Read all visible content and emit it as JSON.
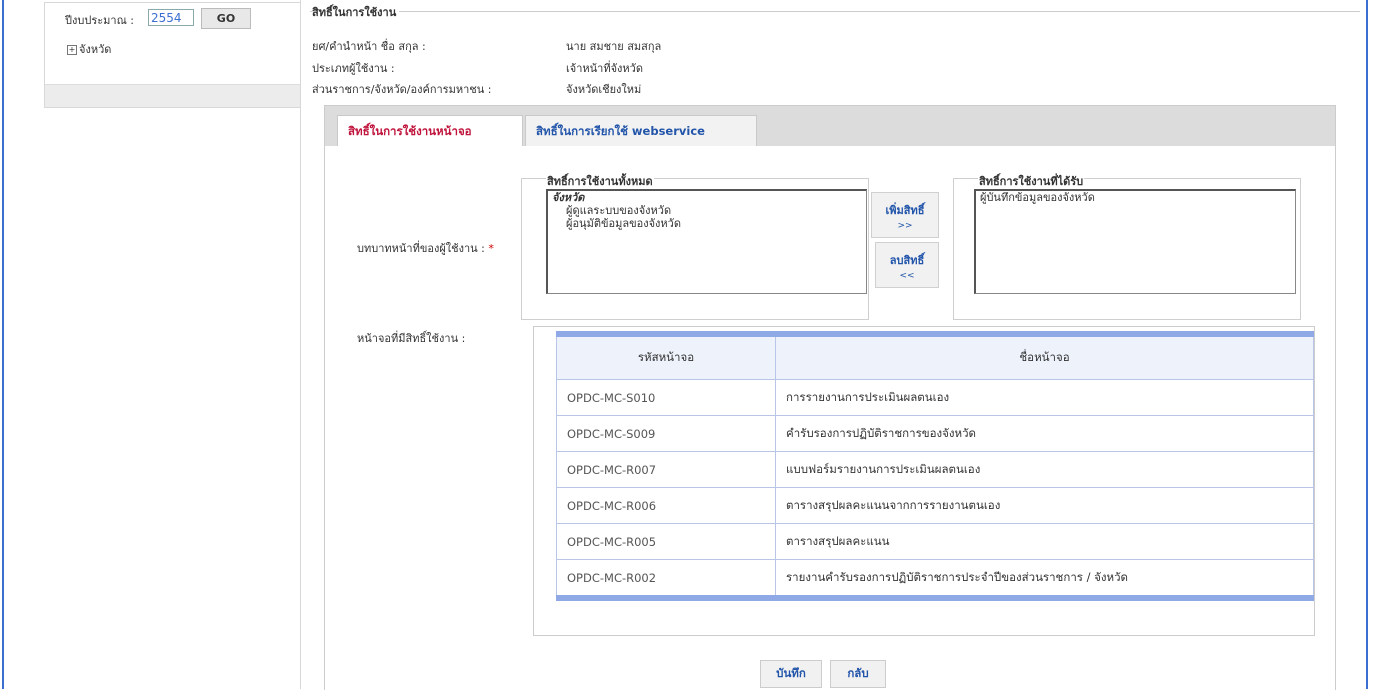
{
  "sidebar": {
    "fiscal_year_label": "ปีงบประมาณ :",
    "fiscal_year_value": "2554",
    "go_label": "GO",
    "tree_root": "จังหวัด",
    "tree_expand_glyph": "+"
  },
  "user_info": {
    "section_title": "สิทธิ์ในการใช้งาน",
    "rows": [
      {
        "label": "ยศ/คำนำหน้า ชื่อ สกุล :",
        "value": "นาย สมชาย สมสกุล"
      },
      {
        "label": "ประเภทผู้ใช้งาน :",
        "value": "เจ้าหน้าที่จังหวัด"
      },
      {
        "label": "ส่วนราชการ/จังหวัด/องค์การมหาชน :",
        "value": "จังหวัดเชียงใหม่"
      }
    ]
  },
  "tabs": [
    {
      "label": "สิทธิ์ในการใช้งานหน้าจอ",
      "active": true
    },
    {
      "label": "สิทธิ์ในการเรียกใช้ webservice",
      "active": false
    }
  ],
  "roles": {
    "label": "บทบาทหน้าที่ของผู้ใช้งาน :",
    "required_mark": "*",
    "all_legend": "สิทธิ์การใช้งานทั้งหมด",
    "all_group": "จังหวัด",
    "all_items": [
      "ผู้ดูแลระบบของจังหวัด",
      "ผู้อนุมัติข้อมูลของจังหวัด"
    ],
    "granted_legend": "สิทธิ์การใช้งานที่ได้รับ",
    "granted_items": [
      "ผู้บันทึกข้อมูลของจังหวัด"
    ],
    "add_label": "เพิ่มสิทธิ์",
    "add_arrows": ">>",
    "remove_label": "ลบสิทธิ์",
    "remove_arrows": "<<"
  },
  "screens": {
    "label": "หน้าจอที่มีสิทธิ์ใช้งาน :",
    "headers": {
      "code": "รหัสหน้าจอ",
      "name": "ชื่อหน้าจอ"
    },
    "rows": [
      {
        "code": "OPDC-MC-S010",
        "name": "การรายงานการประเมินผลตนเอง"
      },
      {
        "code": "OPDC-MC-S009",
        "name": "คำรับรองการปฏิบัติราชการของจังหวัด"
      },
      {
        "code": "OPDC-MC-R007",
        "name": "แบบฟอร์มรายงานการประเมินผลตนเอง"
      },
      {
        "code": "OPDC-MC-R006",
        "name": "ตารางสรุปผลคะแนนจากการรายงานตนเอง"
      },
      {
        "code": "OPDC-MC-R005",
        "name": "ตารางสรุปผลคะแนน"
      },
      {
        "code": "OPDC-MC-R002",
        "name": "รายงานคำรับรองการปฏิบัติราชการประจำปีของส่วนราชการ / จังหวัด"
      }
    ]
  },
  "actions": {
    "save_label": "บันทึก",
    "back_label": "กลับ"
  }
}
